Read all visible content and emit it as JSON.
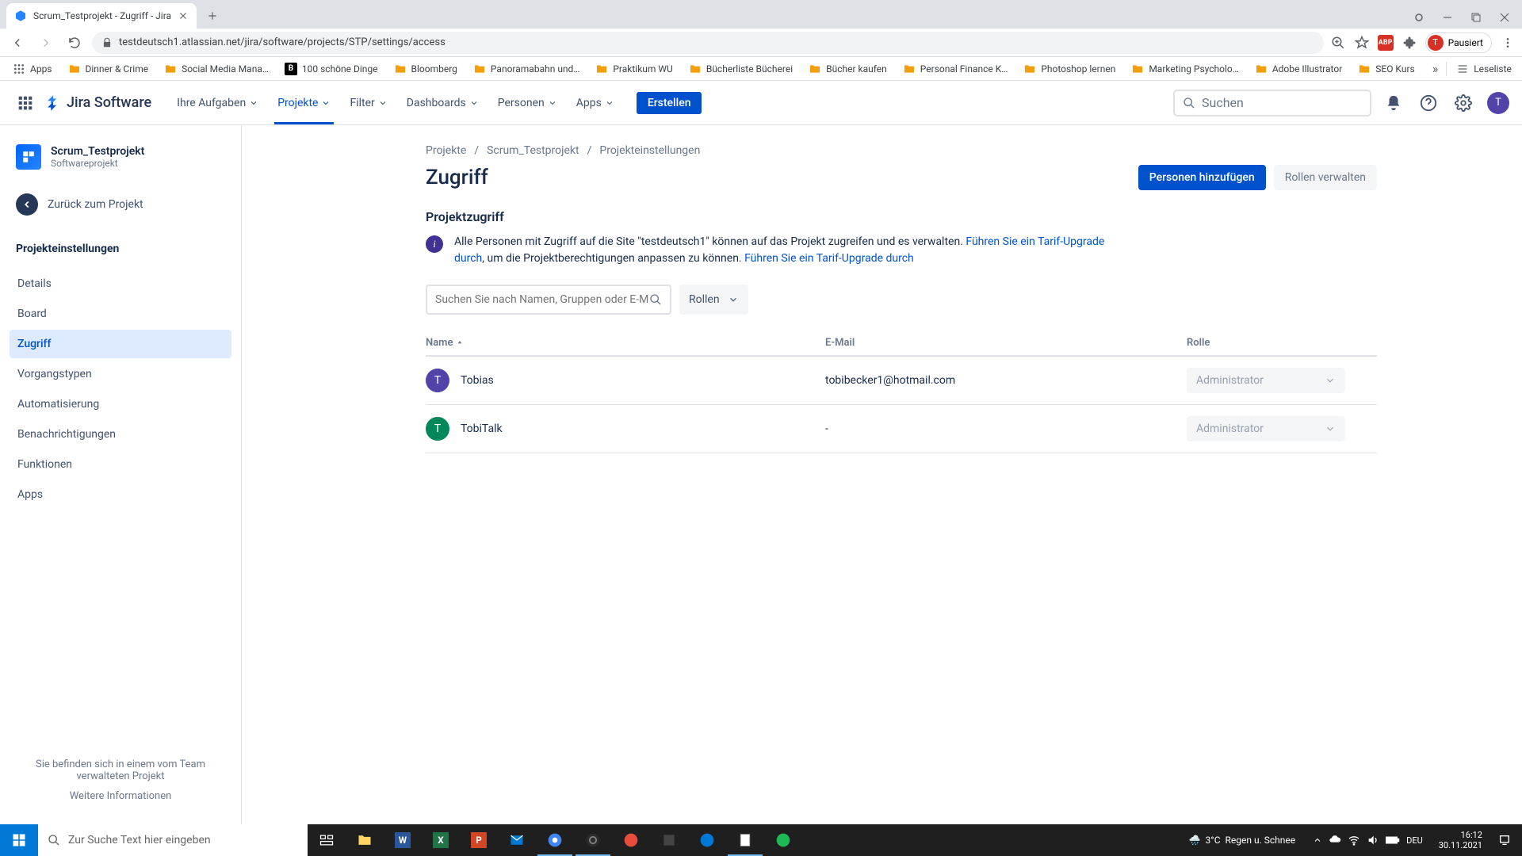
{
  "browser": {
    "tab_title": "Scrum_Testprojekt - Zugriff - Jira",
    "url": "testdeutsch1.atlassian.net/jira/software/projects/STP/settings/access",
    "profile_status": "Pausiert",
    "bookmarks": [
      {
        "label": "Apps",
        "kind": "apps"
      },
      {
        "label": "Dinner & Crime",
        "color": "#f59e0b"
      },
      {
        "label": "Social Media Mana…",
        "color": "#f59e0b"
      },
      {
        "label": "100 schöne Dinge",
        "color": "#000"
      },
      {
        "label": "Bloomberg",
        "color": "#f59e0b"
      },
      {
        "label": "Panoramabahn und…",
        "color": "#f59e0b"
      },
      {
        "label": "Praktikum WU",
        "color": "#f59e0b"
      },
      {
        "label": "Bücherliste Bücherei",
        "color": "#f59e0b"
      },
      {
        "label": "Bücher kaufen",
        "color": "#f59e0b"
      },
      {
        "label": "Personal Finance K…",
        "color": "#f59e0b"
      },
      {
        "label": "Photoshop lernen",
        "color": "#f59e0b"
      },
      {
        "label": "Marketing Psycholo…",
        "color": "#f59e0b"
      },
      {
        "label": "Adobe Illustrator",
        "color": "#f59e0b"
      },
      {
        "label": "SEO Kurs",
        "color": "#f59e0b"
      }
    ],
    "bookmarks_right": {
      "label": "Leseliste"
    }
  },
  "jira": {
    "logo_text": "Jira Software",
    "nav": [
      {
        "label": "Ihre Aufgaben"
      },
      {
        "label": "Projekte",
        "active": true
      },
      {
        "label": "Filter"
      },
      {
        "label": "Dashboards"
      },
      {
        "label": "Personen"
      },
      {
        "label": "Apps"
      }
    ],
    "create": "Erstellen",
    "search_placeholder": "Suchen"
  },
  "sidebar": {
    "project_name": "Scrum_Testprojekt",
    "project_type": "Softwareprojekt",
    "back": "Zurück zum Projekt",
    "heading": "Projekteinstellungen",
    "items": [
      {
        "label": "Details"
      },
      {
        "label": "Board"
      },
      {
        "label": "Zugriff",
        "active": true
      },
      {
        "label": "Vorgangstypen"
      },
      {
        "label": "Automatisierung"
      },
      {
        "label": "Benachrichtigungen"
      },
      {
        "label": "Funktionen"
      },
      {
        "label": "Apps"
      }
    ],
    "footer_text": "Sie befinden sich in einem vom Team verwalteten Projekt",
    "footer_link": "Weitere Informationen"
  },
  "page": {
    "breadcrumbs": [
      "Projekte",
      "Scrum_Testprojekt",
      "Projekteinstellungen"
    ],
    "title": "Zugriff",
    "add_people": "Personen hinzufügen",
    "manage_roles": "Rollen verwalten",
    "section": "Projektzugriff",
    "info_pre": "Alle Personen mit Zugriff auf die Site \"testdeutsch1\" können auf das Projekt zugreifen und es verwalten. ",
    "info_link1": "Führen Sie ein Tarif-Upgrade durch",
    "info_mid": ", um die Projektberechtigungen anpassen zu können. ",
    "info_link2": "Führen Sie ein Tarif-Upgrade durch",
    "search_placeholder": "Suchen Sie nach Namen, Gruppen oder E-Mail-A",
    "roles_filter": "Rollen",
    "columns": {
      "name": "Name",
      "email": "E-Mail",
      "role": "Rolle"
    },
    "rows": [
      {
        "avatar_letter": "T",
        "avatar_color": "#5243aa",
        "name": "Tobias",
        "email": "tobibecker1@hotmail.com",
        "role": "Administrator"
      },
      {
        "avatar_letter": "T",
        "avatar_color": "#00875a",
        "name": "TobiTalk",
        "email": "-",
        "role": "Administrator"
      }
    ]
  },
  "taskbar": {
    "search_placeholder": "Zur Suche Text hier eingeben",
    "weather_temp": "3°C",
    "weather_text": "Regen u. Schnee",
    "time": "16:12",
    "date": "30.11.2021"
  }
}
